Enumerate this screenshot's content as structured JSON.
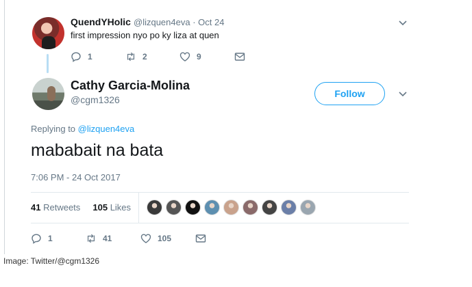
{
  "parent_tweet": {
    "name": "QuendYHolic",
    "handle_and_date": "@lizquen4eva · Oct 24",
    "text": "first impression nyo po ky liza at quen",
    "replies": "1",
    "retweets": "2",
    "likes": "9"
  },
  "main_tweet": {
    "name": "Cathy Garcia-Molina",
    "handle": "@cgm1326",
    "follow_label": "Follow",
    "replying_prefix": "Replying to ",
    "replying_to": "@lizquen4eva",
    "text": "mababait na bata",
    "timestamp": "7:06 PM - 24 Oct 2017",
    "retweets_count": "41",
    "retweets_label": "Retweets",
    "likes_count": "105",
    "likes_label": "Likes",
    "actions": {
      "replies": "1",
      "retweets": "41",
      "likes": "105"
    }
  },
  "liker_avatars": [
    "#3a3a3a",
    "#555555",
    "#111111",
    "#5d8fb0",
    "#c9a28c",
    "#8a6a6a",
    "#444444",
    "#6b7fa8",
    "#9aa6b0"
  ],
  "caption": "Image: Twitter/@cgm1326",
  "colors": {
    "accent": "#1da1f2",
    "muted": "#657786",
    "text": "#14171a"
  },
  "icons": [
    "reply-icon",
    "retweet-icon",
    "like-icon",
    "message-icon",
    "chevron-down-icon"
  ]
}
